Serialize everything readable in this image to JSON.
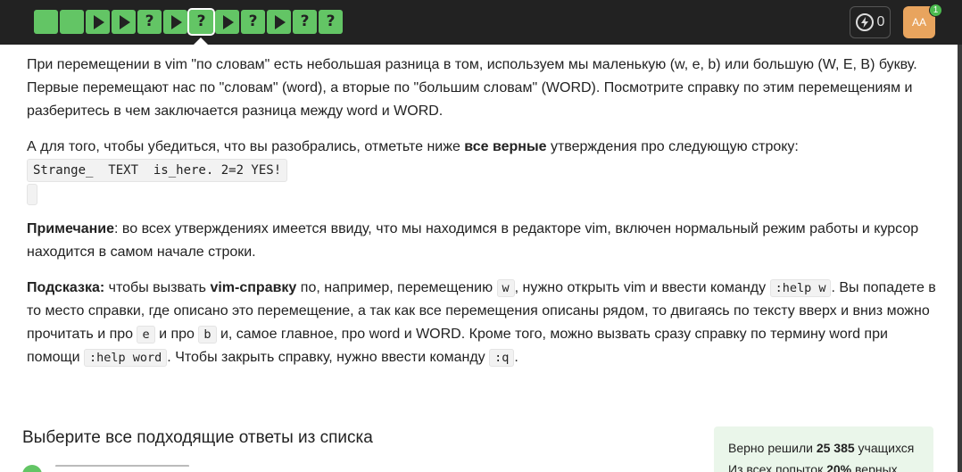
{
  "steps": [
    {
      "type": "square"
    },
    {
      "type": "square"
    },
    {
      "type": "play"
    },
    {
      "type": "play"
    },
    {
      "type": "question"
    },
    {
      "type": "play"
    },
    {
      "type": "question",
      "active": true
    },
    {
      "type": "play"
    },
    {
      "type": "question"
    },
    {
      "type": "play"
    },
    {
      "type": "question"
    },
    {
      "type": "question"
    }
  ],
  "step_symbols": {
    "question": "?"
  },
  "header": {
    "energy_count": "0",
    "avatar_initials": "AA",
    "notification_count": "1"
  },
  "colors": {
    "step_green": "#63c565",
    "topbar": "#222222",
    "avatar": "#e8a45e",
    "stats_bg": "#eaf6ea"
  },
  "content": {
    "p1": "При перемещении в vim \"по словам\" есть небольшая разница в том, используем мы маленькую (w, e, b) или большую (W, E, B) букву. Первые перемещают нас по \"словам\" (word), а вторые по \"большим словам\" (WORD). Посмотрите справку по этим перемещениям и разберитесь в чем заключается разница между word и WORD.",
    "p2_before": "А для того, чтобы убедиться, что вы разобрались, отметьте ниже ",
    "p2_bold": "все верные",
    "p2_after": " утверждения про следующую строку:",
    "code_line": "Strange_  TEXT  is_here. 2=2 YES!",
    "note_label": "Примечание",
    "note_text": ": во всех утверждениях имеется ввиду, что мы находимся в редакторе vim, включен нормальный режим работы и курсор находится в самом начале строки.",
    "hint_label": "Подсказка:",
    "hint_1": " чтобы вызвать ",
    "hint_bold": "vim-справку",
    "hint_2": " по, например, перемещению ",
    "hint_code_w": "w",
    "hint_3": ", нужно открыть vim и ввести команду ",
    "hint_code_help_w": ":help w",
    "hint_4": ". Вы попадете в то место справки, где описано это перемещение, а так как все перемещения описаны рядом, то двигаясь по тексту вверх и вниз можно прочитать и про ",
    "hint_code_e": "e",
    "hint_5": " и про ",
    "hint_code_b": "b",
    "hint_6": " и, самое главное, про word и WORD. Кроме того, можно вызвать сразу справку по термину word при помощи ",
    "hint_code_help_word": ":help word",
    "hint_7": ". Чтобы закрыть справку, нужно ввести команду ",
    "hint_code_q": ":q",
    "hint_8": "."
  },
  "answers": {
    "title": "Выберите все подходящие ответы из списка"
  },
  "stats": {
    "line1_prefix": "Верно решили ",
    "line1_count": "25 385",
    "line1_suffix": " учащихся",
    "line2_prefix": "Из всех попыток ",
    "line2_percent": "20%",
    "line2_suffix": " верных"
  }
}
